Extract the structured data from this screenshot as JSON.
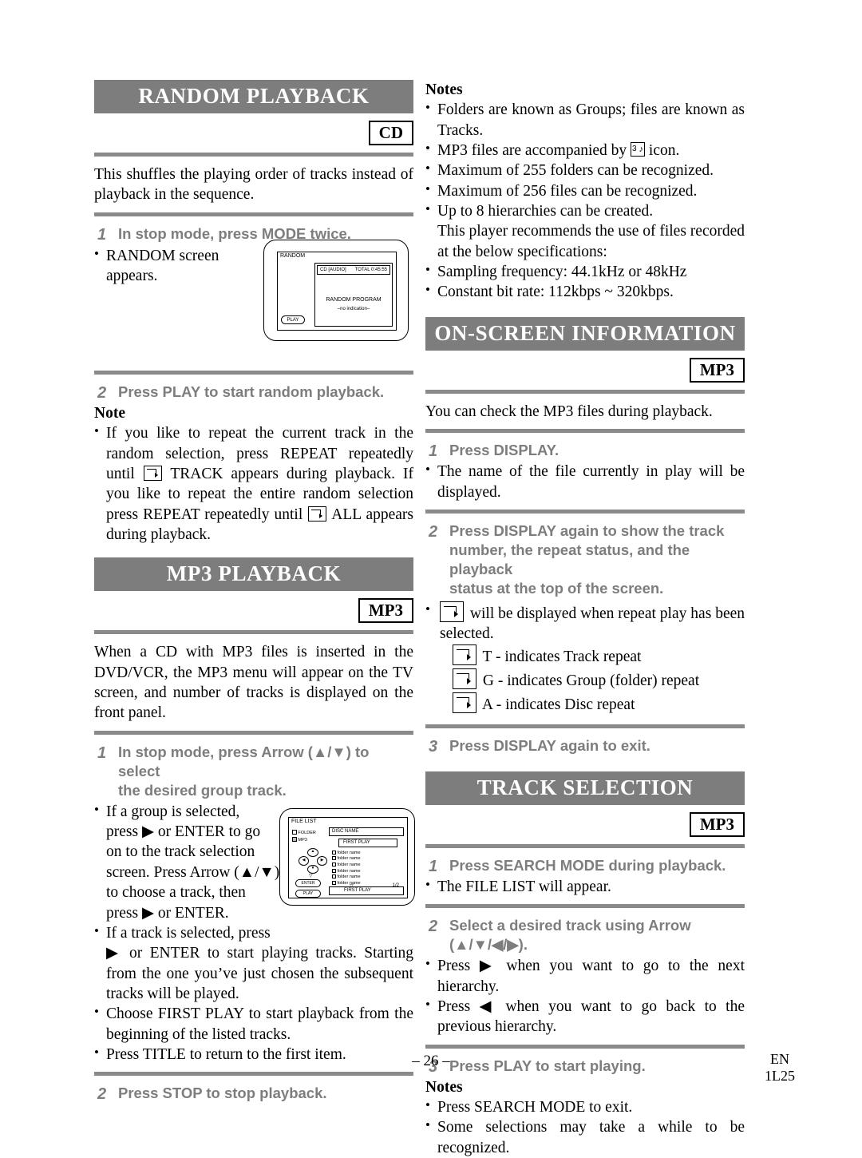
{
  "page": {
    "number": "– 26 –",
    "lang_code": "EN",
    "doc_code": "1L25"
  },
  "left_column": {
    "random_playback": {
      "title": "RANDOM PLAYBACK",
      "badge": "CD",
      "intro": "This shuffles the playing order of tracks instead of playback in the sequence.",
      "step1_num": "1",
      "step1": "In stop mode, press MODE twice.",
      "bullet1_a": "RANDOM screen",
      "bullet1_b": "appears.",
      "step2_num": "2",
      "step2": "Press PLAY to start random playback.",
      "note_heading": "Note",
      "note_pre": "If you like to repeat the current track in the random selection, press REPEAT repeatedly until",
      "note_mid": "TRACK appears during playback. If you like to repeat the entire random selection press REPEAT repeatedly until",
      "note_post": "ALL appears during playback."
    },
    "random_screen": {
      "title": "RANDOM",
      "source": "CD  [AUDIO]",
      "total": "TOTAL 0:45:55",
      "program_label": "RANDOM PROGRAM",
      "no_indication": "–no indication–",
      "play_button": "PLAY"
    },
    "mp3_playback": {
      "title": "MP3 PLAYBACK",
      "badge": "MP3",
      "intro": "When a CD with MP3 files is inserted in the DVD/VCR, the MP3 menu will appear on the TV screen, and number of tracks is displayed on the front panel.",
      "step1_num": "1",
      "step1_l1": "In stop mode, press Arrow (▲/▼) to select",
      "step1_l2": "the desired group track.",
      "b1_l1": "If a group is selected,",
      "b1_l2": "press ▶ or ENTER to go",
      "b1_l3": "on to the track selection",
      "b1_l4": "screen. Press Arrow (▲/▼)",
      "b1_l5": "to choose a track, then",
      "b1_l6": "press ▶ or ENTER.",
      "b2_l1": "If a track is selected, press",
      "b2_rest": "▶ or ENTER to start playing tracks. Starting from the one you’ve just chosen the subsequent tracks will be played.",
      "b3": "Choose FIRST PLAY to start playback from the beginning of the listed tracks.",
      "b4": "Press TITLE to return to the first item.",
      "step2_num": "2",
      "step2": "Press STOP to stop playback."
    },
    "file_list_screen": {
      "title": "FILE LIST",
      "legend_folder": "FOLDER",
      "legend_mp3": "MP3",
      "disc_name": "DISC NAME",
      "first_play_top": "FIRST PLAY",
      "rows": [
        "folder name",
        "folder name",
        "folder name",
        "folder name",
        "folder name",
        "folder name"
      ],
      "page_indicator": "1/2",
      "enter_button": "ENTER",
      "play_button": "PLAY",
      "first_play_bottom": "FIRST PLAY"
    }
  },
  "right_column": {
    "mp3_notes": {
      "heading": "Notes",
      "items": [
        "Folders are known as Groups; files are known as Tracks.",
        "MP3 files are accompanied by  icon.",
        "Maximum of 255 folders can be recognized.",
        "Maximum of 256 files can be recognized.",
        "Up to 8 hierarchies can be created.",
        "Sampling frequency: 44.1kHz or 48kHz",
        "Constant bit rate: 112kbps ~ 320kbps."
      ],
      "item2_pre": "MP3 files are accompanied by",
      "item2_post": "icon.",
      "item5_cont": "This player recommends the use of files recorded at the below specifications:"
    },
    "on_screen_information": {
      "title": "ON-SCREEN INFORMATION",
      "badge": "MP3",
      "intro": "You can check the MP3 files during playback.",
      "step1_num": "1",
      "step1": "Press DISPLAY.",
      "b1": "The name of the file currently in play will be displayed.",
      "step2_num": "2",
      "step2_l1": "Press DISPLAY again to show the track",
      "step2_l2": "number, the repeat status, and the playback",
      "step2_l3": "status at the top of the screen.",
      "b2_post": "will be displayed when repeat play has been selected.",
      "repeat_t": "T - indicates Track repeat",
      "repeat_g": "G - indicates Group (folder) repeat",
      "repeat_a": "A - indicates Disc repeat",
      "step3_num": "3",
      "step3": "Press DISPLAY again to exit."
    },
    "track_selection": {
      "title": "TRACK SELECTION",
      "badge": "MP3",
      "step1_num": "1",
      "step1": "Press SEARCH MODE during playback.",
      "b1": "The FILE LIST will appear.",
      "step2_num": "2",
      "step2_l1": "Select a desired track using Arrow",
      "step2_l2": "(▲/▼/◀/▶).",
      "b2": "Press ▶ when you want to go to the next hierarchy.",
      "b3": "Press ◀ when you want to go back to the previous hierarchy.",
      "step3_num": "3",
      "step3": "Press PLAY to start playing.",
      "notes_heading": "Notes",
      "n1": "Press SEARCH MODE to exit.",
      "n2": "Some selections may take a while to be recognized."
    }
  },
  "colors": {
    "band_gray": "#7d7d7d",
    "rule_gray": "#8a8a8a",
    "step_gray": "#7d7d7d"
  }
}
